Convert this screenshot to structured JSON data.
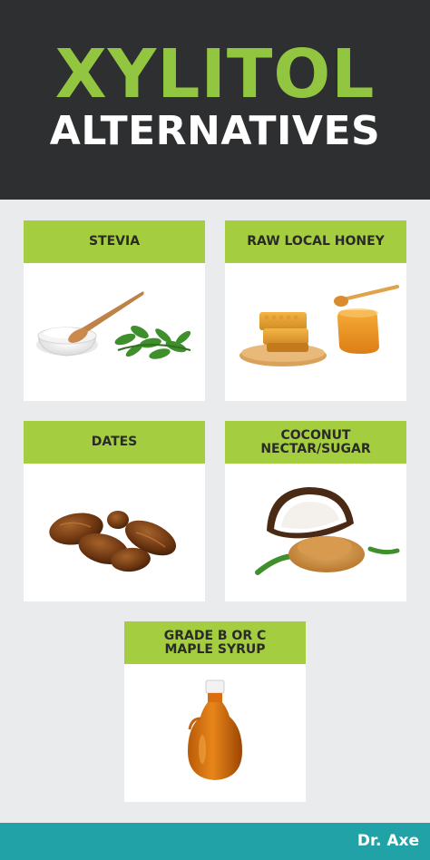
{
  "header": {
    "title": "XYLITOL",
    "subtitle": "ALTERNATIVES"
  },
  "cards": [
    {
      "label": "STEVIA",
      "image": "stevia-powder-spoon-leaves"
    },
    {
      "label": "RAW LOCAL HONEY",
      "image": "honeycomb-and-honey-jar"
    },
    {
      "label": "DATES",
      "image": "dried-dates"
    },
    {
      "label": "COCONUT\nNECTAR/SUGAR",
      "image": "coconut-and-sugar"
    },
    {
      "label": "GRADE B OR C\nMAPLE SYRUP",
      "image": "maple-syrup-bottle"
    }
  ],
  "footer": {
    "brand": "Dr. Axe"
  },
  "colors": {
    "header_bg": "#2e2f31",
    "title_green": "#93c640",
    "label_green": "#a4cd3f",
    "page_bg": "#eaebec",
    "footer_teal": "#20a2a6"
  }
}
